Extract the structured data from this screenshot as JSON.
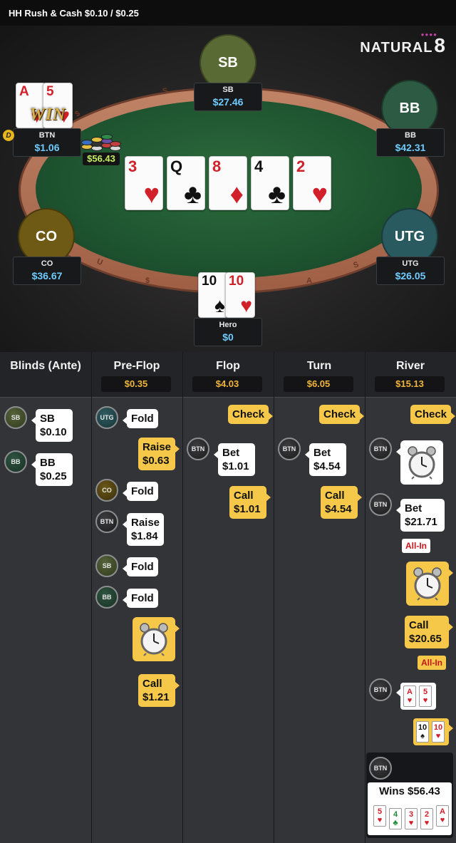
{
  "header": {
    "title": "HH  Rush & Cash $0.10 / $0.25"
  },
  "brand": {
    "name": "NATURAL",
    "digit": "8",
    "dots": "●●●●"
  },
  "rail_text": [
    "S",
    "U",
    "$",
    "S",
    "A",
    "$"
  ],
  "seats": {
    "sb": {
      "label": "SB",
      "name": "SB",
      "stack": "$27.46",
      "color": "#5a6a35"
    },
    "bb": {
      "label": "BB",
      "name": "BB",
      "stack": "$42.31",
      "color": "#2c5a42"
    },
    "btn": {
      "name": "BTN",
      "stack": "$1.06"
    },
    "co": {
      "label": "CO",
      "name": "CO",
      "stack": "$36.67",
      "color": "#6e5a14"
    },
    "utg": {
      "label": "UTG",
      "name": "UTG",
      "stack": "$26.05",
      "color": "#285a60"
    },
    "hero": {
      "name": "Hero",
      "stack": "$0"
    }
  },
  "btn_cards": [
    {
      "rank": "A",
      "suit": "♥",
      "color": "red"
    },
    {
      "rank": "5",
      "suit": "♥",
      "color": "red"
    }
  ],
  "hero_cards": [
    {
      "rank": "10",
      "suit": "♠",
      "color": "black"
    },
    {
      "rank": "10",
      "suit": "♥",
      "color": "red"
    }
  ],
  "win_badge": "WIN",
  "dealer_button": "D",
  "pot_amount": "$56.43",
  "board": [
    {
      "rank": "3",
      "suit": "♥",
      "color": "red"
    },
    {
      "rank": "Q",
      "suit": "♣",
      "color": "black"
    },
    {
      "rank": "8",
      "suit": "♦",
      "color": "red"
    },
    {
      "rank": "4",
      "suit": "♣",
      "color": "black"
    },
    {
      "rank": "2",
      "suit": "♥",
      "color": "red"
    }
  ],
  "columns": {
    "blinds": {
      "title": "Blinds (Ante)"
    },
    "preflop": {
      "title": "Pre-Flop",
      "pot": "$0.35"
    },
    "flop": {
      "title": "Flop",
      "pot": "$4.03"
    },
    "turn": {
      "title": "Turn",
      "pot": "$6.05"
    },
    "river": {
      "title": "River",
      "pot": "$15.13"
    }
  },
  "actions": {
    "blinds": [
      {
        "pos": "SB",
        "label": "SB",
        "amount": "$0.10"
      },
      {
        "pos": "BB",
        "label": "BB",
        "amount": "$0.25"
      }
    ],
    "preflop": [
      {
        "pos": "UTG",
        "label": "Fold"
      },
      {
        "label": "Raise",
        "amount": "$0.63"
      },
      {
        "pos": "CO",
        "label": "Fold"
      },
      {
        "pos": "BTN",
        "label": "Raise",
        "amount": "$1.84"
      },
      {
        "pos": "SB",
        "label": "Fold"
      },
      {
        "pos": "BB",
        "label": "Fold"
      },
      {
        "label": "Call",
        "amount": "$1.21"
      }
    ],
    "flop": [
      {
        "label": "Check"
      },
      {
        "pos": "BTN",
        "label": "Bet",
        "amount": "$1.01"
      },
      {
        "label": "Call",
        "amount": "$1.01"
      }
    ],
    "turn": [
      {
        "label": "Check"
      },
      {
        "pos": "BTN",
        "label": "Bet",
        "amount": "$4.54"
      },
      {
        "label": "Call",
        "amount": "$4.54"
      }
    ],
    "river": [
      {
        "label": "Check"
      },
      {
        "pos": "BTN"
      },
      {
        "pos": "BTN",
        "label": "Bet",
        "amount": "$21.71",
        "tag": "All-In"
      },
      {
        "label": "Call",
        "amount": "$20.65",
        "tag": "All-In"
      },
      {
        "pos": "BTN"
      }
    ]
  },
  "showdown": {
    "btn_cards": [
      {
        "rank": "A",
        "suit": "♥",
        "color": "red"
      },
      {
        "rank": "5",
        "suit": "♥",
        "color": "red"
      }
    ],
    "hero_cards": [
      {
        "rank": "10",
        "suit": "♠",
        "color": "black"
      },
      {
        "rank": "10",
        "suit": "♥",
        "color": "red"
      }
    ]
  },
  "winner": {
    "pos": "BTN",
    "text": "Wins $56.43",
    "cards": [
      {
        "rank": "5",
        "suit": "♥",
        "color": "red"
      },
      {
        "rank": "4",
        "suit": "♣",
        "color": "green"
      },
      {
        "rank": "3",
        "suit": "♥",
        "color": "red"
      },
      {
        "rank": "2",
        "suit": "♥",
        "color": "red"
      },
      {
        "rank": "A",
        "suit": "♥",
        "color": "red"
      }
    ]
  }
}
